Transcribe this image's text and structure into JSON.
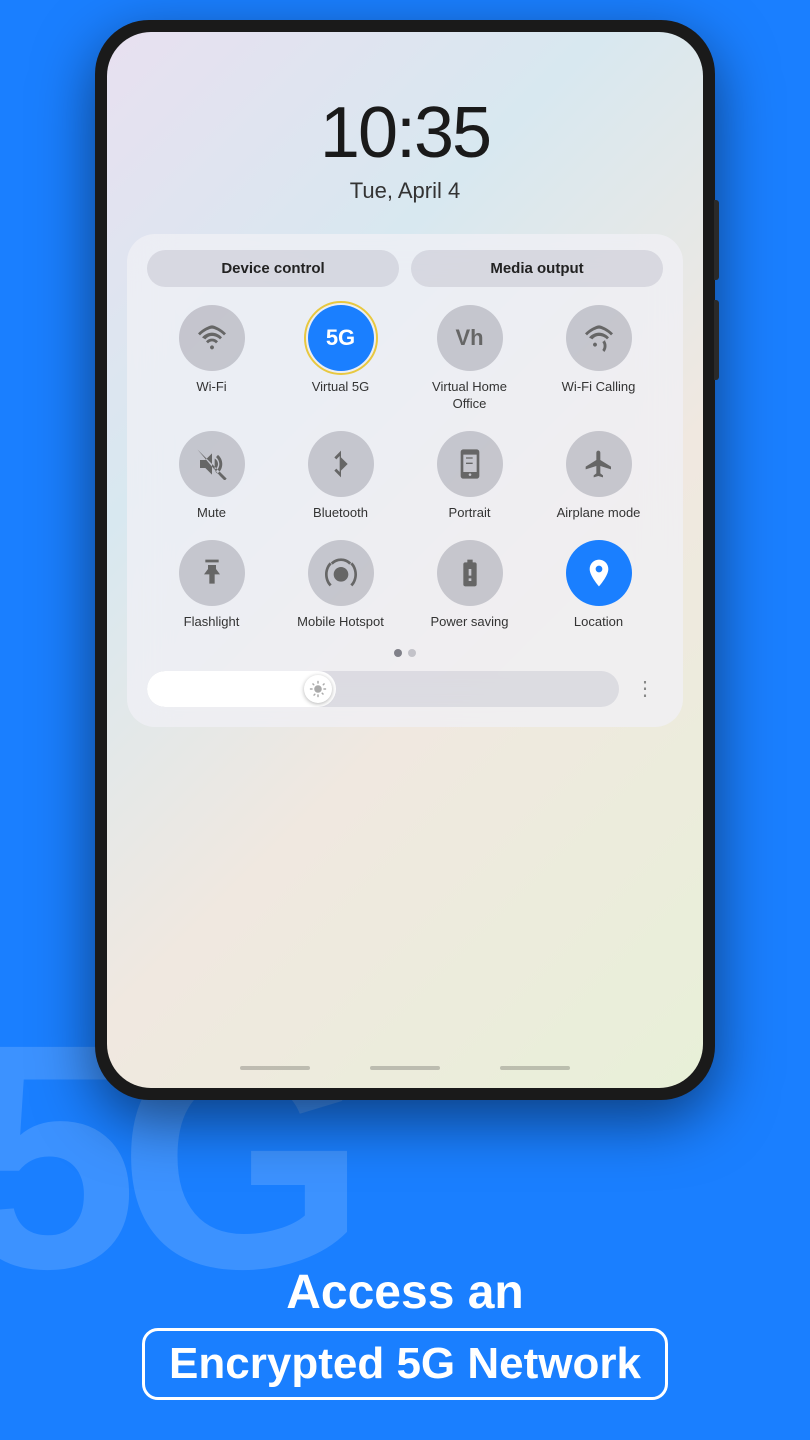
{
  "background": {
    "color": "#1a7fff",
    "watermark": "5G"
  },
  "clock": {
    "time": "10:35",
    "date": "Tue, April 4"
  },
  "top_buttons": [
    {
      "id": "device-control",
      "label": "Device control"
    },
    {
      "id": "media-output",
      "label": "Media output"
    }
  ],
  "control_rows": [
    [
      {
        "id": "wifi",
        "label": "Wi-Fi",
        "icon": "wifi",
        "active": false
      },
      {
        "id": "virtual-5g",
        "label": "Virtual 5G",
        "icon": "5g",
        "active": true,
        "highlighted": true
      },
      {
        "id": "virtual-home-office",
        "label": "Virtual Home Office",
        "icon": "vh",
        "active": false
      },
      {
        "id": "wifi-calling",
        "label": "Wi-Fi Calling",
        "icon": "wifi-phone",
        "active": false
      }
    ],
    [
      {
        "id": "mute",
        "label": "Mute",
        "icon": "mute",
        "active": false
      },
      {
        "id": "bluetooth",
        "label": "Bluetooth",
        "icon": "bluetooth",
        "active": false
      },
      {
        "id": "portrait",
        "label": "Portrait",
        "icon": "portrait",
        "active": false
      },
      {
        "id": "airplane-mode",
        "label": "Airplane mode",
        "icon": "airplane",
        "active": false
      }
    ],
    [
      {
        "id": "flashlight",
        "label": "Flashlight",
        "icon": "flashlight",
        "active": false
      },
      {
        "id": "mobile-hotspot",
        "label": "Mobile Hotspot",
        "icon": "hotspot",
        "active": false
      },
      {
        "id": "power-saving",
        "label": "Power saving",
        "icon": "power-saving",
        "active": false
      },
      {
        "id": "location",
        "label": "Location",
        "icon": "location",
        "active": true
      }
    ]
  ],
  "pagination": {
    "dots": 2,
    "active": 0
  },
  "brightness": {
    "level": 40,
    "icon": "sun"
  },
  "bottom_text": {
    "line1": "Access an",
    "line2": "Encrypted 5G Network"
  }
}
